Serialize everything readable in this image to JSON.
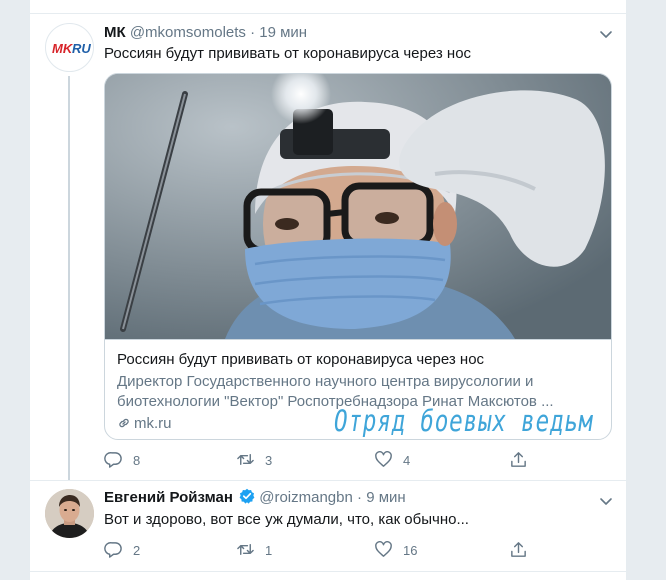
{
  "tweets": [
    {
      "name": "МК",
      "handle": "@mkomsomolets",
      "separator": "·",
      "time": "19 мин",
      "avatar_text": "MKRU",
      "text": "Россиян будут прививать от коронавируса через нос",
      "card": {
        "title": "Россиян будут прививать от коронавируса через нос",
        "description": "Директор Государственного научного центра вирусологии и биотехнологии \"Вектор\" Роспотребнадзора Ринат Максютов ...",
        "domain": "mk.ru",
        "watermark": "Отряд боевых ведьм"
      },
      "replies": "8",
      "retweets": "3",
      "likes": "4"
    },
    {
      "name": "Евгений Ройзман",
      "handle": "@roizmangbn",
      "separator": "·",
      "time": "9 мин",
      "text": "Вот и здорово, вот все уж думали, что, как обычно...",
      "replies": "2",
      "retweets": "1",
      "likes": "16"
    }
  ],
  "colors": {
    "accent": "#1da1f2",
    "muted": "#657786",
    "border": "#e6ecf0",
    "watermark": "#3fa5d9",
    "mk_red": "#d7242a",
    "mk_blue": "#1f5fa8"
  },
  "icons": [
    "chevron-down-icon",
    "verified-icon",
    "link-icon",
    "reply-icon",
    "retweet-icon",
    "like-icon",
    "share-icon"
  ]
}
